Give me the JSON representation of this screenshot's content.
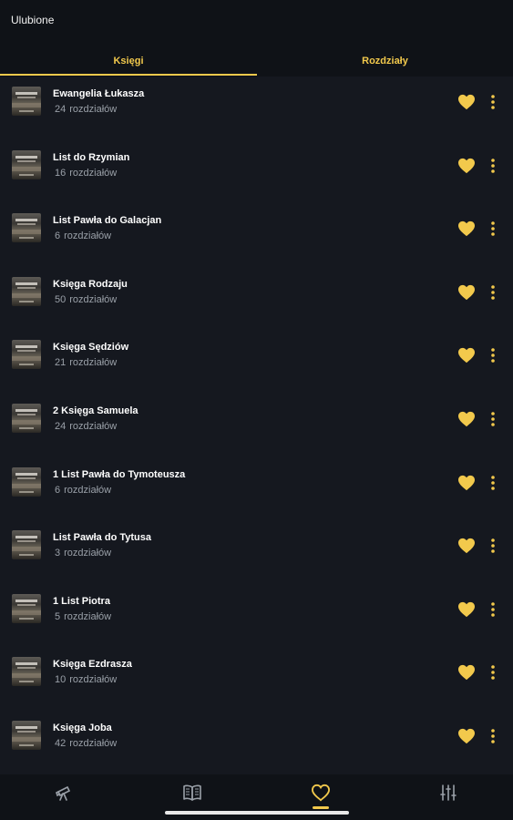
{
  "header": {
    "title": "Ulubione"
  },
  "tabs": [
    {
      "label": "Księgi",
      "active": true
    },
    {
      "label": "Rozdziały",
      "active": false
    }
  ],
  "books": [
    {
      "name": "Ewangelia Łukasza",
      "count": "24",
      "unit": "rozdziałów"
    },
    {
      "name": "List do Rzymian",
      "count": "16",
      "unit": "rozdziałów"
    },
    {
      "name": "List Pawła do Galacjan",
      "count": "6",
      "unit": "rozdziałów"
    },
    {
      "name": "Księga Rodzaju",
      "count": "50",
      "unit": "rozdziałów"
    },
    {
      "name": "Księga Sędziów",
      "count": "21",
      "unit": "rozdziałów"
    },
    {
      "name": "2 Księga Samuela",
      "count": "24",
      "unit": "rozdziałów"
    },
    {
      "name": "1 List Pawła do Tymoteusza",
      "count": "6",
      "unit": "rozdziałów"
    },
    {
      "name": "List Pawła do Tytusa",
      "count": "3",
      "unit": "rozdziałów"
    },
    {
      "name": "1 List Piotra",
      "count": "5",
      "unit": "rozdziałów"
    },
    {
      "name": "Księga Ezdrasza",
      "count": "10",
      "unit": "rozdziałów"
    },
    {
      "name": "Księga Joba",
      "count": "42",
      "unit": "rozdziałów"
    }
  ],
  "bottom_nav": [
    {
      "icon": "telescope-icon",
      "active": false
    },
    {
      "icon": "book-icon",
      "active": false
    },
    {
      "icon": "heart-icon",
      "active": true
    },
    {
      "icon": "sliders-icon",
      "active": false
    }
  ],
  "colors": {
    "accent": "#f2c94c",
    "background": "#15181f",
    "bar": "#0f1217",
    "muted": "#9aa0a8"
  }
}
